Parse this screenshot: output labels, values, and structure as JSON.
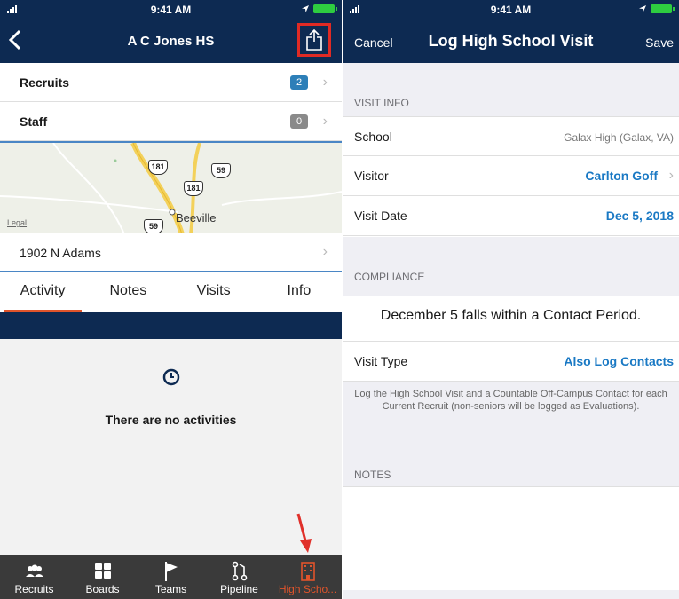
{
  "status_bar": {
    "time": "9:41 AM"
  },
  "left": {
    "title": "A C Jones HS",
    "rows": [
      {
        "label": "Recruits",
        "count": "2",
        "badge_color": "#2d7fb8"
      },
      {
        "label": "Staff",
        "count": "0",
        "badge_color": "#8a8a8a"
      }
    ],
    "map": {
      "routes": [
        "181",
        "59",
        "181",
        "59"
      ],
      "town": "Beeville",
      "legal": "Legal"
    },
    "address": "1902 N Adams",
    "tabs": [
      "Activity",
      "Notes",
      "Visits",
      "Info"
    ],
    "active_tab": "Activity",
    "empty_message": "There are no activities",
    "bottom_tabs": [
      {
        "label": "Recruits",
        "icon": "people-icon"
      },
      {
        "label": "Boards",
        "icon": "grid-icon"
      },
      {
        "label": "Teams",
        "icon": "flag-icon"
      },
      {
        "label": "Pipeline",
        "icon": "pipeline-icon"
      },
      {
        "label": "High Scho...",
        "icon": "building-icon",
        "active": true
      }
    ],
    "accent_color": "#e0542b",
    "nav_color": "#0d2a52"
  },
  "right": {
    "cancel_label": "Cancel",
    "title": "Log High School Visit",
    "save_label": "Save",
    "visit_info_header": "VISIT INFO",
    "school_label": "School",
    "school_value": "Galax High (Galax, VA)",
    "visitor_label": "Visitor",
    "visitor_value": "Carlton Goff",
    "visit_date_label": "Visit Date",
    "visit_date_value": "Dec 5, 2018",
    "compliance_header": "COMPLIANCE",
    "compliance_message": "December 5 falls within a Contact Period.",
    "visit_type_label": "Visit Type",
    "visit_type_value": "Also Log Contacts",
    "footnote": "Log the High School Visit and a Countable Off-Campus Contact for each Current Recruit (non-seniors will be logged as Evaluations).",
    "notes_header": "NOTES",
    "link_color": "#1a79c4"
  }
}
